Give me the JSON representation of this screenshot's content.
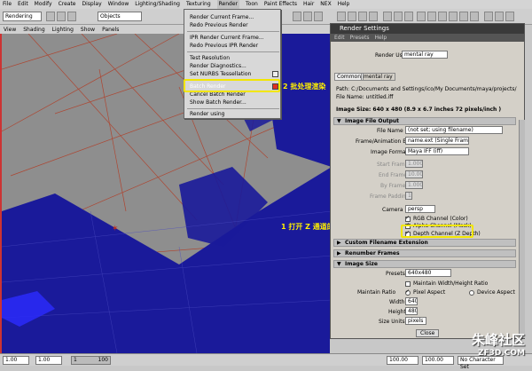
{
  "menubar": {
    "items": [
      "File",
      "Edit",
      "Modify",
      "Create",
      "Display",
      "Window",
      "Lighting/Shading",
      "Texturing",
      "Render",
      "Toon",
      "Paint Effects",
      "Hair",
      "NEX",
      "Help"
    ],
    "active": "Render"
  },
  "toolbar": {
    "menuset": "Rendering",
    "selection_mask": "Objects"
  },
  "panel": {
    "menus": [
      "View",
      "Shading",
      "Lighting",
      "Show",
      "Panels"
    ]
  },
  "render_menu": {
    "items": [
      "Render Current Frame...",
      "Redo Previous Render",
      "IPR Render Current Frame...",
      "Redo Previous IPR Render",
      "Test Resolution",
      "Render Diagnostics...",
      "Set NURBS Tessellation",
      "Batch Render",
      "Cancel Batch Render",
      "Show Batch Render...",
      "Render using"
    ]
  },
  "annotations": {
    "step1": "1 打开 Z 通道的渲染",
    "step2": "2 批处理渲染"
  },
  "render_settings": {
    "title": "Render Settings",
    "menus": [
      "Edit",
      "Presets",
      "Help"
    ],
    "render_using_label": "Render Using",
    "render_using_value": "mental ray",
    "tabs": [
      "Common",
      "mental ray"
    ],
    "path": "Path: C:/Documents and Settings/ico/My Documents/maya/projects/",
    "file_name": "File Name: untitled.iff",
    "image_size_info": "Image Size: 640 x 480 (8.9 x 6.7 inches 72 pixels/inch )",
    "image_file_output": "Image File Output",
    "file_name_prefix_label": "File Name Prefix",
    "file_name_prefix_value": "(not set; using filename)",
    "frame_ext_label": "Frame/Animation Ext",
    "frame_ext_value": "name.ext (Single Frame)",
    "image_format_label": "Image Format",
    "image_format_value": "Maya IFF (iff)",
    "start_frame_label": "Start Frame",
    "start_frame_value": "1.000",
    "end_frame_label": "End Frame",
    "end_frame_value": "10.000",
    "by_frame_label": "By Frame",
    "by_frame_value": "1.000",
    "frame_padding_label": "Frame Padding",
    "frame_padding_value": "1",
    "camera_label": "Camera",
    "camera_value": "persp",
    "rgb_channel": "RGB Channel (Color)",
    "alpha_channel": "Alpha Channel (Mask)",
    "depth_channel": "Depth Channel (Z Depth)",
    "custom_filename": "Custom Filename Extension",
    "renumber_frames": "Renumber Frames",
    "image_size_section": "Image Size",
    "presets_label": "Presets",
    "presets_value": "640x480",
    "maintain_wh": "Maintain Width/Height Ratio",
    "maintain_ratio_label": "Maintain Ratio",
    "pixel_aspect": "Pixel Aspect",
    "device_aspect": "Device Aspect",
    "width_label": "Width",
    "width_value": "640",
    "height_label": "Height",
    "height_value": "480",
    "size_units_label": "Size Units",
    "size_units_value": "pixels",
    "close_button": "Close"
  },
  "statusbar": {
    "f1": "1.00",
    "f2": "1.00",
    "f3": "1",
    "f4": "100",
    "f5": "100.00",
    "f6": "100.00",
    "f7": "No Character Set"
  },
  "watermark": {
    "main": "朱峰社区",
    "sub": "ZF3D.COM"
  },
  "colors": {
    "menu_highlight": "#0a246a",
    "annotation": "#f2e600",
    "viewport_bg": "#8e8e8e",
    "wire": "#1a1a9a"
  }
}
